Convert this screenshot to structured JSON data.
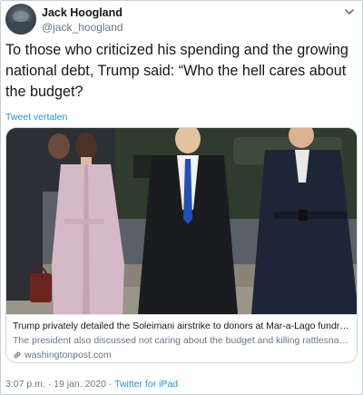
{
  "author": {
    "name": "Jack Hoogland",
    "handle": "@jack_hoogland"
  },
  "tweet": {
    "text": "To those who criticized his spending and the growing national debt, Trump said: “Who the hell cares about the budget?",
    "translate_label": "Tweet vertalen"
  },
  "card": {
    "title": "Trump privately detailed the Soleimani airstrike to donors at Mar-a-Lago fundrai...",
    "description": "The president also discussed not caring about the budget and killing rattlesnakes.",
    "domain": "washingtonpost.com"
  },
  "footer": {
    "time": "3:07 p.m.",
    "separator": " · ",
    "date": "19 jan. 2020",
    "source": "Twitter for iPad"
  },
  "icons": {
    "menu": "chevron-down-icon",
    "link": "link-icon"
  },
  "colors": {
    "link_blue": "#1b95e0",
    "secondary_text": "#657786"
  }
}
